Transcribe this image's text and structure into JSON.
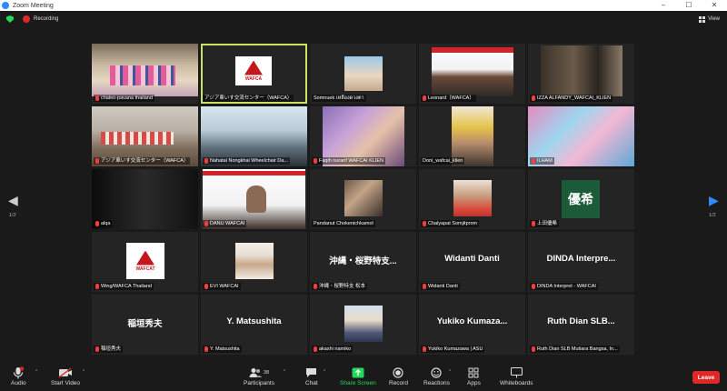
{
  "window": {
    "title": "Zoom Meeting"
  },
  "topbar": {
    "recording": "Recording",
    "view": "View"
  },
  "nav": {
    "page_left": "1/2",
    "page_right": "1/2"
  },
  "colors": {
    "accent": "#2d8cff",
    "active_speaker": "#c8e264",
    "leave": "#e02828",
    "recording": "#e02828",
    "muted": "#ff3b3b"
  },
  "tiles": [
    {
      "name": "chaleo-pavana thailand",
      "kind": "video"
    },
    {
      "name": "アジア車いす交流センター（WAFCA）",
      "kind": "logo",
      "active": true
    },
    {
      "name": "Somnuek เหลืองดวงตา",
      "kind": "video"
    },
    {
      "name": "Leonard（WAFCA）",
      "kind": "video"
    },
    {
      "name": "IZZA ALFANDY_WAFCAI_KLIEN",
      "kind": "video"
    },
    {
      "name": "アジア車いす交流センター（WAFCA）",
      "kind": "video"
    },
    {
      "name": "Nahatai Nongkhai Wheelchair Da...",
      "kind": "video"
    },
    {
      "name": "Faqih nurarif WAFCAI KLIEN",
      "kind": "video"
    },
    {
      "name": "Doni_wafcai_klien",
      "kind": "video"
    },
    {
      "name": "ILHAM",
      "kind": "video"
    },
    {
      "name": "alqa",
      "kind": "video"
    },
    {
      "name": "DANU WAFCAI",
      "kind": "video"
    },
    {
      "name": "Pandanut Chokenichkamol",
      "kind": "video"
    },
    {
      "name": "Chalyapat Somjitprom",
      "kind": "video"
    },
    {
      "name": "上田優希",
      "kind": "avatar",
      "avatar": "優希"
    },
    {
      "name": "Wing/WAFCA Thailand",
      "kind": "logo"
    },
    {
      "name": "EVI WAFCAI",
      "kind": "video"
    },
    {
      "name": "沖縄・桜野特支 松本",
      "kind": "text",
      "display": "沖縄・桜野特支..."
    },
    {
      "name": "Widanti Danti",
      "kind": "text",
      "display": "Widanti Danti"
    },
    {
      "name": "DINDA Interpret - WAFCAI",
      "kind": "text",
      "display": "DINDA Interpre..."
    },
    {
      "name": "稲垣秀夫",
      "kind": "text",
      "display": "稲垣秀夫"
    },
    {
      "name": "Y. Matsushita",
      "kind": "text",
      "display": "Y. Matsushita"
    },
    {
      "name": "akashi namiko",
      "kind": "video"
    },
    {
      "name": "Yukiko Kumazawa | ASU",
      "kind": "text",
      "display": "Yukiko Kumaza..."
    },
    {
      "name": "Ruth Dian SLB Mutiara Bangsa, In...",
      "kind": "text",
      "display": "Ruth Dian SLB..."
    }
  ],
  "logo_text": "WAFCA",
  "logo_text_alt": "WAFCAT",
  "toolbar": {
    "audio": "Audio",
    "video": "Start Video",
    "participants": "Participants",
    "participants_count": "38",
    "chat": "Chat",
    "share": "Share Screen",
    "record": "Record",
    "reactions": "Reactions",
    "apps": "Apps",
    "whiteboards": "Whiteboards",
    "leave": "Leave"
  }
}
